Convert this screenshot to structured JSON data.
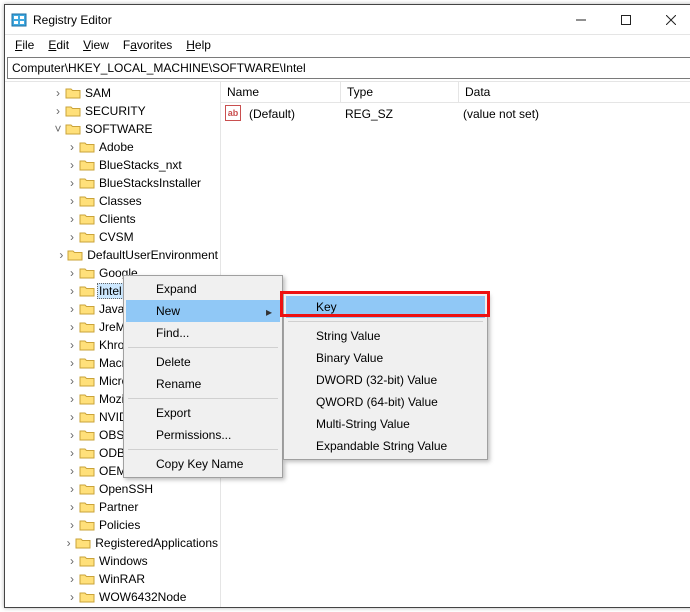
{
  "titlebar": {
    "title": "Registry Editor"
  },
  "menubar": {
    "file": "File",
    "edit": "Edit",
    "view": "View",
    "favorites": "Favorites",
    "help": "Help"
  },
  "address": "Computer\\HKEY_LOCAL_MACHINE\\SOFTWARE\\Intel",
  "list": {
    "cols": {
      "name": "Name",
      "type": "Type",
      "data": "Data"
    },
    "rows": [
      {
        "name": "(Default)",
        "type": "REG_SZ",
        "data": "(value not set)"
      }
    ]
  },
  "tree": {
    "top": [
      {
        "label": "SAM",
        "depth": 3
      },
      {
        "label": "SECURITY",
        "depth": 3
      },
      {
        "label": "SOFTWARE",
        "depth": 3,
        "expanded": true
      }
    ],
    "sw": [
      "Adobe",
      "BlueStacks_nxt",
      "BlueStacksInstaller",
      "Classes",
      "Clients",
      "CVSM",
      "DefaultUserEnvironment",
      "Google",
      "Intel",
      "JavaSoft",
      "JreMetrics",
      "Khronos",
      "Macrium",
      "Microsoft",
      "Mozilla",
      "NVIDIA Corporation",
      "OBS Studio",
      "ODBC",
      "OEM",
      "OpenSSH",
      "Partner",
      "Policies",
      "RegisteredApplications",
      "Windows",
      "WinRAR",
      "WOW6432Node"
    ],
    "selected": "Intel"
  },
  "ctx1": {
    "expand": "Expand",
    "new": "New",
    "find": "Find...",
    "delete": "Delete",
    "rename": "Rename",
    "export": "Export",
    "permissions": "Permissions...",
    "copy": "Copy Key Name"
  },
  "ctx2": {
    "key": "Key",
    "string": "String Value",
    "binary": "Binary Value",
    "dword": "DWORD (32-bit) Value",
    "qword": "QWORD (64-bit) Value",
    "multi": "Multi-String Value",
    "expand": "Expandable String Value"
  }
}
